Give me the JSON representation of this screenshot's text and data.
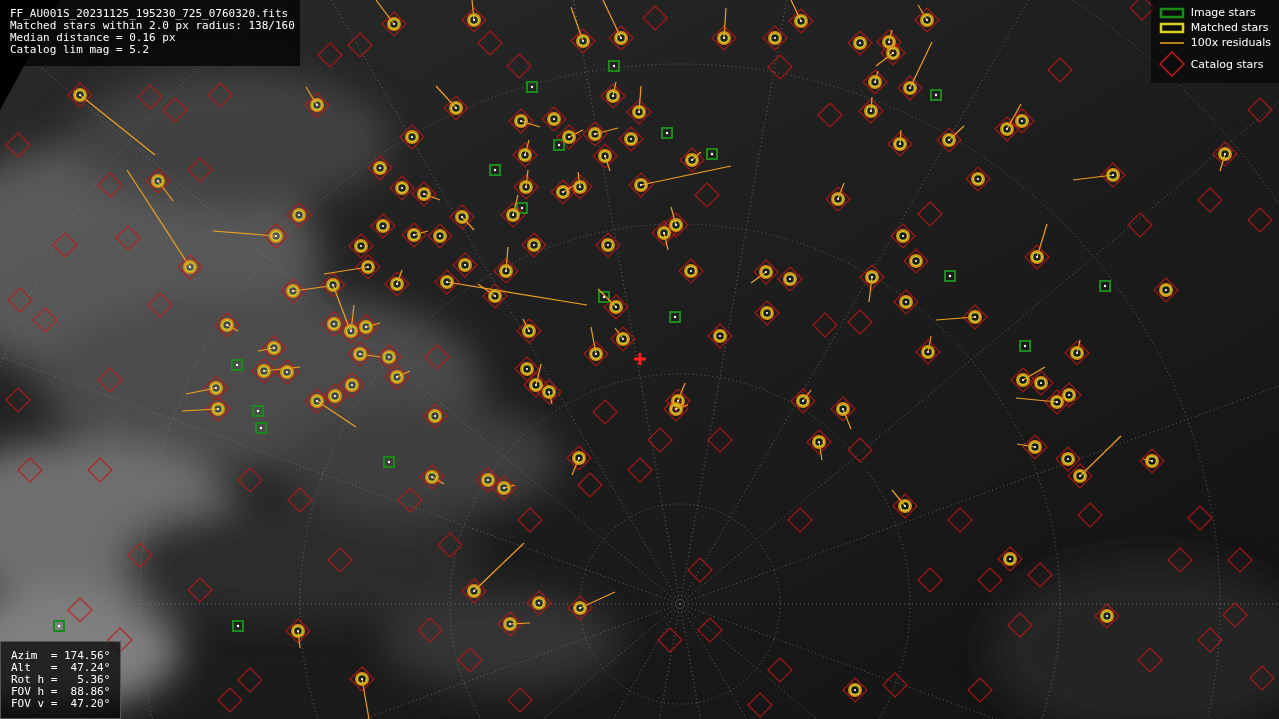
{
  "info": {
    "lines": [
      "FF_AU001S_20231125_195230_725_0760320.fits",
      "Matched stars within 2.0 px radius: 138/160",
      "Median distance = 0.16 px",
      "Catalog lim mag = 5.2"
    ]
  },
  "legend": [
    {
      "label": "Image stars"
    },
    {
      "kind": "matched",
      "label": "Matched stars"
    },
    {
      "kind": "residual",
      "label": "100x residuals"
    },
    {
      "kind": "catalog",
      "label": "Catalog stars"
    }
  ],
  "pointing": {
    "lines": [
      "Azim  = 174.56°",
      "Alt   =  47.24°",
      "Rot h =   5.36°",
      "FOV h =  88.86°",
      "FOV v =  47.20°"
    ]
  }
}
